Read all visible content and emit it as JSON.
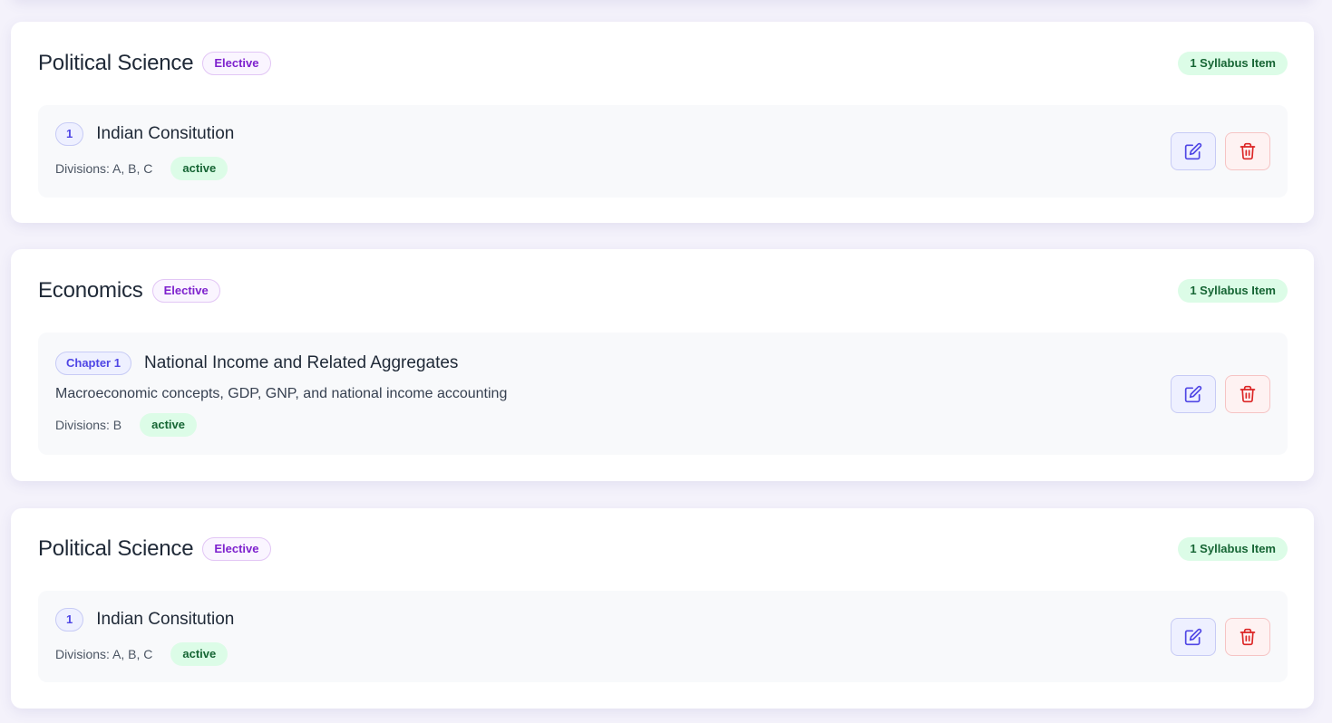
{
  "subjects": [
    {
      "title": "Political Science",
      "type_label": "Elective",
      "count_label": "1 Syllabus Item",
      "item": {
        "number_label": "1",
        "title": "Indian Consitution",
        "description": "",
        "divisions": "Divisions: A, B, C",
        "status": "active"
      }
    },
    {
      "title": "Economics",
      "type_label": "Elective",
      "count_label": "1 Syllabus Item",
      "item": {
        "number_label": "Chapter 1",
        "title": "National Income and Related Aggregates",
        "description": "Macroeconomic concepts, GDP, GNP, and national income accounting",
        "divisions": "Divisions: B",
        "status": "active"
      }
    },
    {
      "title": "Political Science",
      "type_label": "Elective",
      "count_label": "1 Syllabus Item",
      "item": {
        "number_label": "1",
        "title": "Indian Consitution",
        "description": "",
        "divisions": "Divisions: A, B, C",
        "status": "active"
      }
    }
  ],
  "icons": {
    "edit": "edit-icon",
    "delete": "trash-icon"
  },
  "colors": {
    "accent": "#4f46e5",
    "elective": "#7e22ce",
    "success": "#166534",
    "danger": "#dc2626"
  }
}
